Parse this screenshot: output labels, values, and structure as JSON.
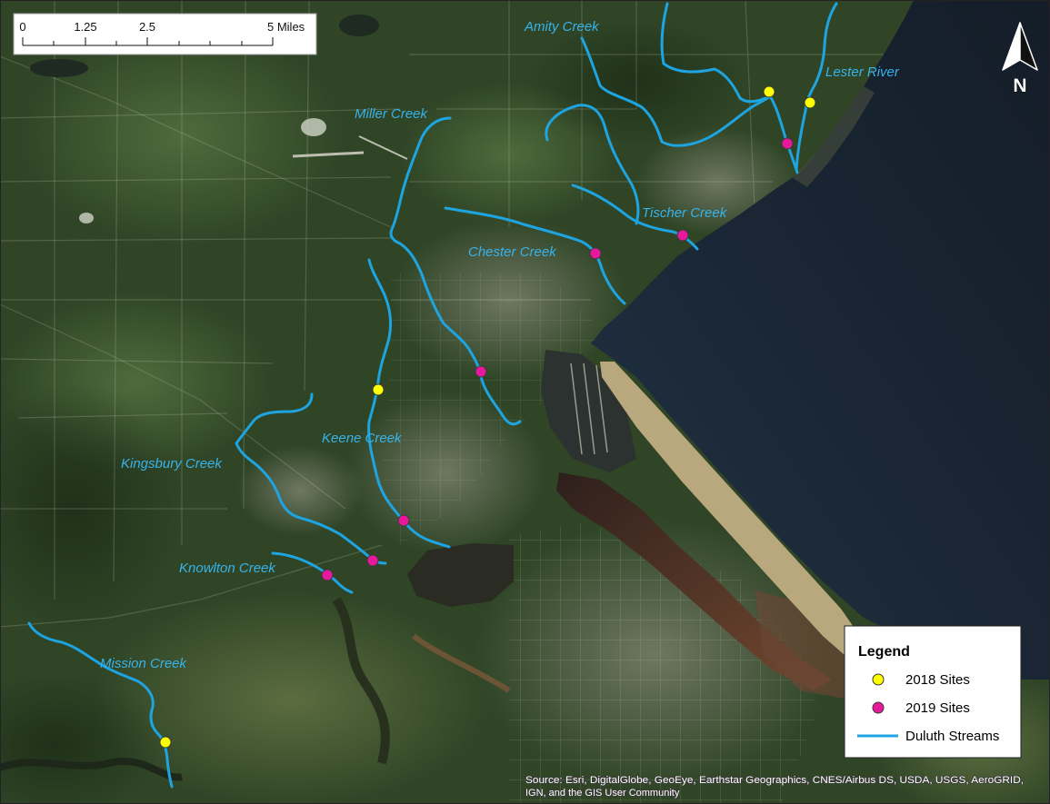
{
  "scale_bar": {
    "tick_labels": [
      "0",
      "1.25",
      "2.5",
      "5 Miles"
    ]
  },
  "north_arrow": {
    "label": "N",
    "icon": "north-arrow-icon"
  },
  "stream_labels": {
    "amity_creek": "Amity Creek",
    "lester_river": "Lester River",
    "miller_creek": "Miller Creek",
    "tischer_creek": "Tischer Creek",
    "chester_creek": "Chester Creek",
    "keene_creek": "Keene Creek",
    "kingsbury_creek": "Kingsbury Creek",
    "knowlton_creek": "Knowlton Creek",
    "mission_creek": "Mission Creek"
  },
  "legend": {
    "title": "Legend",
    "items": [
      {
        "label": "2018 Sites",
        "symbol": "circle",
        "color": "#ffff00"
      },
      {
        "label": "2019 Sites",
        "symbol": "circle",
        "color": "#e8189c"
      },
      {
        "label": "Duluth Streams",
        "symbol": "line",
        "color": "#1ea4e0"
      }
    ]
  },
  "attribution": {
    "lines": [
      "Source: Esri, DigitalGlobe, GeoEye, Earthstar Geographics, CNES/Airbus DS, USDA, USGS, AeroGRID,",
      "IGN, and the GIS User Community"
    ]
  },
  "colors": {
    "stream_label": "#38b2ea"
  }
}
